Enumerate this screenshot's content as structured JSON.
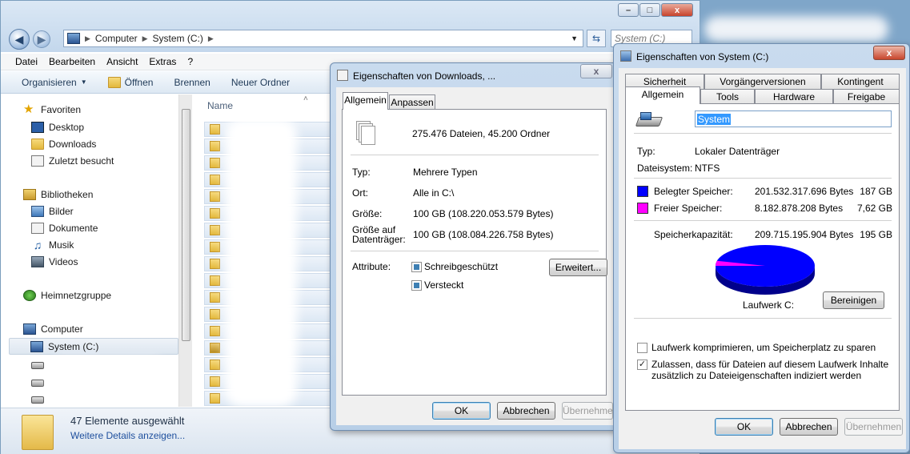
{
  "explorer": {
    "address": [
      "Computer",
      "System (C:)"
    ],
    "search_placeholder": "System (C:)",
    "window_buttons": [
      "–",
      "□",
      "x"
    ],
    "menu": [
      "Datei",
      "Bearbeiten",
      "Ansicht",
      "Extras",
      "?"
    ],
    "toolbar": {
      "organize": "Organisieren",
      "open": "Öffnen",
      "burn": "Brennen",
      "new_folder": "Neuer Ordner"
    },
    "nav": {
      "favorites": "Favoriten",
      "desktop": "Desktop",
      "downloads": "Downloads",
      "recent": "Zuletzt besucht",
      "libraries": "Bibliotheken",
      "pictures": "Bilder",
      "documents": "Dokumente",
      "music": "Musik",
      "videos": "Videos",
      "homegroup": "Heimnetzgruppe",
      "computer": "Computer",
      "system_drive": "System (C:)"
    },
    "column_name": "Name",
    "status": {
      "count": "47 Elemente ausgewählt",
      "details_link": "Weitere Details anzeigen..."
    }
  },
  "downloads_dialog": {
    "title": "Eigenschaften von Downloads, ...",
    "tabs": [
      "Allgemein",
      "Anpassen"
    ],
    "summary": "275.476 Dateien, 45.200 Ordner",
    "fields": {
      "type_label": "Typ:",
      "type_value": "Mehrere Typen",
      "location_label": "Ort:",
      "location_value": "Alle in C:\\",
      "size_label": "Größe:",
      "size_value": "100 GB (108.220.053.579 Bytes)",
      "disk_size_label_1": "Größe auf",
      "disk_size_label_2": "Datenträger:",
      "disk_size_value": "100 GB (108.084.226.758 Bytes)",
      "attributes_label": "Attribute:",
      "readonly": "Schreibgeschützt",
      "hidden": "Versteckt"
    },
    "buttons": {
      "advanced": "Erweitert...",
      "ok": "OK",
      "cancel": "Abbrechen",
      "apply": "Übernehmen"
    }
  },
  "system_dialog": {
    "title": "Eigenschaften von System (C:)",
    "tabs_top": [
      "Sicherheit",
      "Vorgängerversionen",
      "Kontingent"
    ],
    "tabs_bottom": [
      "Allgemein",
      "Tools",
      "Hardware",
      "Freigabe"
    ],
    "name_value": "System",
    "type_label": "Typ:",
    "type_value": "Lokaler Datenträger",
    "fs_label": "Dateisystem:",
    "fs_value": "NTFS",
    "used_label": "Belegter Speicher:",
    "used_bytes": "201.532.317.696 Bytes",
    "used_gb": "187 GB",
    "free_label": "Freier Speicher:",
    "free_bytes": "8.182.878.208 Bytes",
    "free_gb": "7,62 GB",
    "cap_label": "Speicherkapazität:",
    "cap_bytes": "209.715.195.904 Bytes",
    "cap_gb": "195 GB",
    "drive_label": "Laufwerk C:",
    "cleanup": "Bereinigen",
    "compress": "Laufwerk komprimieren, um Speicherplatz zu sparen",
    "index_1": "Zulassen, dass für Dateien auf diesem Laufwerk Inhalte",
    "index_2": "zusätzlich zu Dateieigenschaften indiziert werden",
    "used_fraction": 0.961,
    "colors": {
      "used": "#0000ff",
      "free": "#ff00ff"
    },
    "buttons": {
      "ok": "OK",
      "cancel": "Abbrechen",
      "apply": "Übernehmen"
    }
  }
}
